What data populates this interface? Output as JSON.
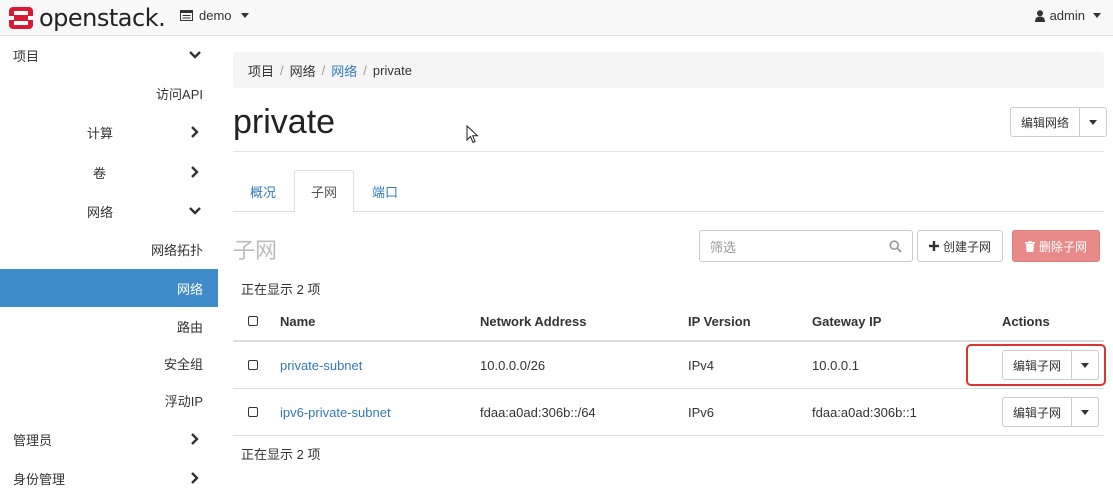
{
  "navbar": {
    "brand": "openstack.",
    "project": "demo",
    "user": "admin"
  },
  "sidebar": {
    "items": [
      {
        "label": "项目"
      },
      {
        "label": "访问API"
      },
      {
        "label": "计算"
      },
      {
        "label": "卷"
      },
      {
        "label": "网络"
      },
      {
        "label": "网络拓扑"
      },
      {
        "label": "网络"
      },
      {
        "label": "路由"
      },
      {
        "label": "安全组"
      },
      {
        "label": "浮动IP"
      },
      {
        "label": "管理员"
      },
      {
        "label": "身份管理"
      }
    ]
  },
  "breadcrumb": {
    "items": [
      "项目",
      "网络",
      "网络",
      "private"
    ],
    "sep": "/"
  },
  "page": {
    "title": "private",
    "edit_network": "编辑网络"
  },
  "tabs": [
    "概况",
    "子网",
    "端口"
  ],
  "subnets": {
    "title": "子网",
    "filter_placeholder": "筛选",
    "create_label": "创建子网",
    "delete_label": "删除子网",
    "count_text": "正在显示 2 项",
    "columns": [
      "Name",
      "Network Address",
      "IP Version",
      "Gateway IP",
      "Actions"
    ],
    "rows": [
      {
        "name": "private-subnet",
        "address": "10.0.0.0/26",
        "ipver": "IPv4",
        "gateway": "10.0.0.1",
        "action": "编辑子网"
      },
      {
        "name": "ipv6-private-subnet",
        "address": "fdaa:a0ad:306b::/64",
        "ipver": "IPv6",
        "gateway": "fdaa:a0ad:306b::1",
        "action": "编辑子网"
      }
    ]
  },
  "colors": {
    "accent": "#3f8ac9",
    "link": "#337ab7",
    "danger": "#e88a88",
    "highlight": "#d9362f"
  }
}
